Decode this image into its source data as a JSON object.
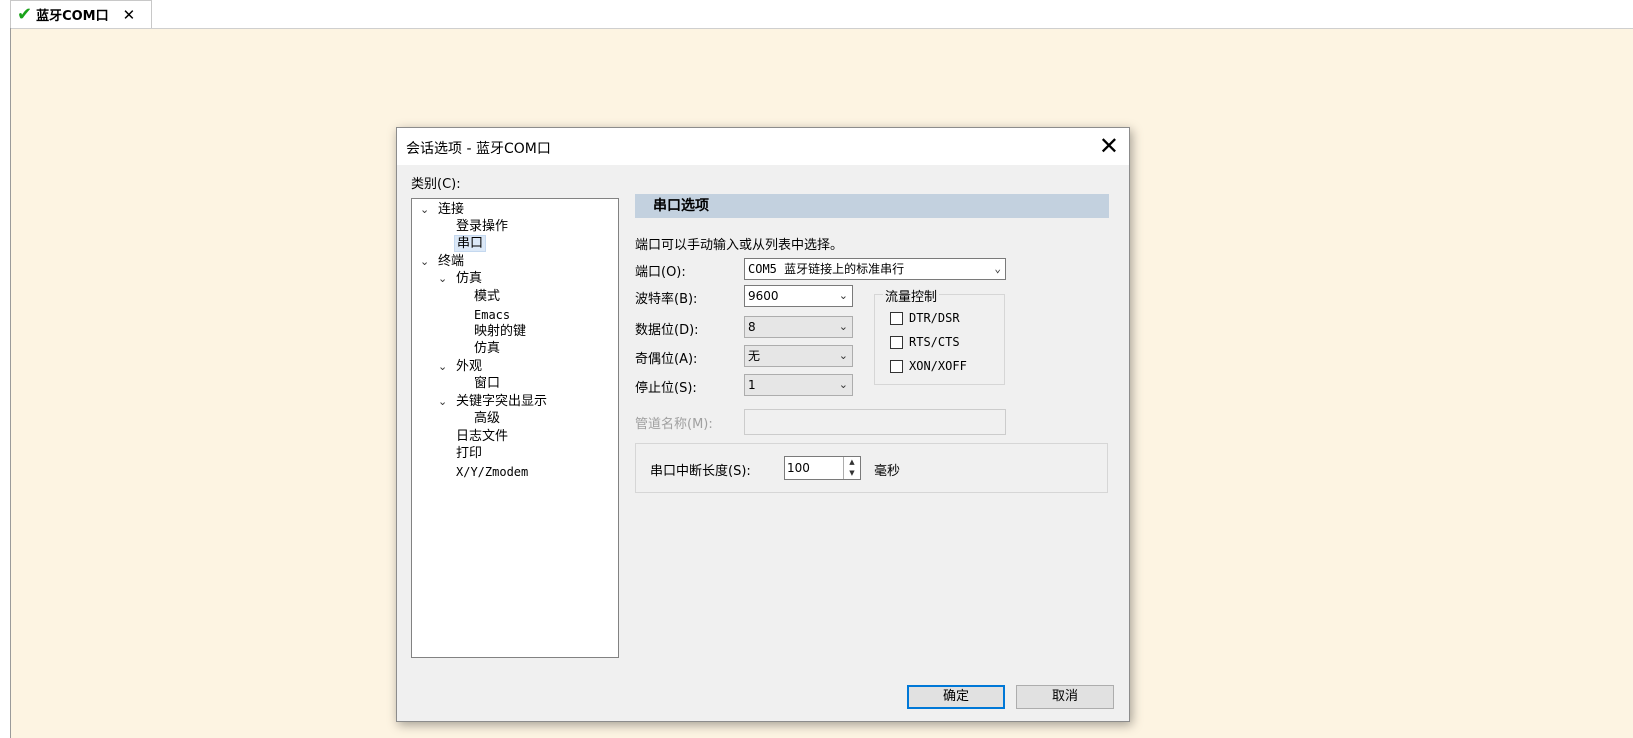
{
  "tab": {
    "label": "蓝牙COM口",
    "status_icon": "checkmark-icon",
    "close": "✕"
  },
  "dialog": {
    "title": "会话选项 - 蓝牙COM口",
    "close": "✕",
    "category_label": "类别(C):",
    "tree": [
      {
        "label": "连接",
        "expanded": true
      },
      {
        "label": "登录操作"
      },
      {
        "label": "串口",
        "selected": true
      },
      {
        "label": "终端",
        "expanded": true
      },
      {
        "label": "仿真",
        "expanded": true
      },
      {
        "label": "模式"
      },
      {
        "label": "Emacs"
      },
      {
        "label": "映射的键"
      },
      {
        "label": "仿真"
      },
      {
        "label": "外观",
        "expanded": true
      },
      {
        "label": "窗口"
      },
      {
        "label": "关键字突出显示",
        "expanded": true
      },
      {
        "label": "高级"
      },
      {
        "label": "日志文件"
      },
      {
        "label": "打印"
      },
      {
        "label": "X/Y/Zmodem"
      }
    ],
    "section_title": "串口选项",
    "hint": "端口可以手动输入或从列表中选择。",
    "port": {
      "label": "端口(O):",
      "value": "COM5 蓝牙链接上的标准串行"
    },
    "baud": {
      "label": "波特率(B):",
      "value": "9600"
    },
    "data_bits": {
      "label": "数据位(D):",
      "value": "8"
    },
    "parity": {
      "label": "奇偶位(A):",
      "value": "无"
    },
    "stop_bits": {
      "label": "停止位(S):",
      "value": "1"
    },
    "pipe_name": {
      "label": "管道名称(M):",
      "value": ""
    },
    "flow_control": {
      "title": "流量控制",
      "options": [
        {
          "label": "DTR/DSR",
          "checked": false
        },
        {
          "label": "RTS/CTS",
          "checked": false
        },
        {
          "label": "XON/XOFF",
          "checked": false
        }
      ]
    },
    "break_length": {
      "label": "串口中断长度(S):",
      "value": "100",
      "unit": "毫秒"
    },
    "ok": "确定",
    "cancel": "取消"
  },
  "colors": {
    "terminal_bg": "#fdf4e2",
    "section_head": "#c3d1df",
    "accent": "#0078d7",
    "check": "#1aa31a"
  }
}
